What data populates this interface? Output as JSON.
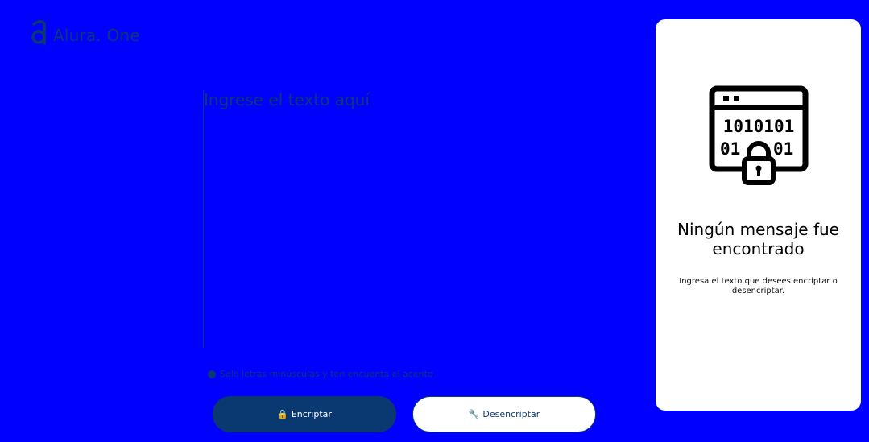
{
  "brand": {
    "logo_text": "Alura. One",
    "logo_icon": "alura-a-icon"
  },
  "input": {
    "placeholder": "Ingrese el texto aquí"
  },
  "hint": {
    "icon": "info-circle-icon",
    "text": "Solo letras minúsculas y ten encuenta el acento"
  },
  "buttons": {
    "encrypt": {
      "icon": "🔒",
      "label": "Encriptar"
    },
    "decrypt": {
      "icon": "🔧",
      "label": "Desencriptar"
    }
  },
  "output_panel": {
    "illustration": "binary-lock-icon",
    "binary_line_1": "1010101",
    "binary_line_2": "01",
    "binary_line_3": "01",
    "title": "Ningún mensaje fue encontrado",
    "description": "Ingresa el texto que desees encriptar o desencriptar."
  },
  "colors": {
    "background": "#0000ff",
    "primary": "#0a3871",
    "panel": "#ffffff"
  }
}
